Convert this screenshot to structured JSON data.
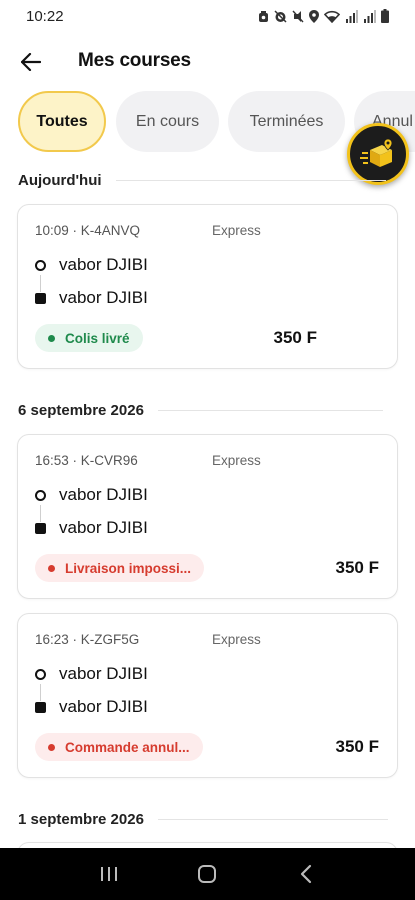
{
  "status_bar": {
    "time": "10:22",
    "icons": [
      "alarm-icon",
      "mute-icon",
      "location-icon",
      "wifi-icon",
      "signal-icon",
      "signal-icon",
      "battery-icon"
    ]
  },
  "header": {
    "back_icon": "arrow-left-icon",
    "title": "Mes courses"
  },
  "tabs": [
    {
      "label": "Toutes",
      "active": true
    },
    {
      "label": "En cours",
      "active": false
    },
    {
      "label": "Terminées",
      "active": false
    },
    {
      "label": "Annul",
      "active": false
    }
  ],
  "fab": {
    "icon": "delivery-box-icon"
  },
  "sections": [
    {
      "title": "Aujourd'hui",
      "courses": [
        {
          "time": "10:09",
          "ref": "K-4ANVQ",
          "meta": "10:09 · K-4ANVQ",
          "type": "Express",
          "origin": "vabor DJIBI",
          "destination": "vabor DJIBI",
          "status": "Colis livré",
          "status_color": "#1f8a4c",
          "price": "350 F"
        }
      ]
    },
    {
      "title": "6 septembre 2026",
      "courses": [
        {
          "time": "16:53",
          "ref": "K-CVR96",
          "meta": "16:53 · K-CVR96",
          "type": "Express",
          "origin": "vabor DJIBI",
          "destination": "vabor DJIBI",
          "status": "Livraison impossi...",
          "status_color": "#d63c2f",
          "price": "350 F"
        },
        {
          "time": "16:23",
          "ref": "K-ZGF5G",
          "meta": "16:23 · K-ZGF5G",
          "type": "Express",
          "origin": "vabor DJIBI",
          "destination": "vabor DJIBI",
          "status": "Commande annul...",
          "status_color": "#d63c2f",
          "price": "350 F"
        }
      ]
    },
    {
      "title": "1 septembre 2026",
      "courses": []
    }
  ],
  "nav_bar": {
    "buttons": [
      "recent-apps-icon",
      "home-icon",
      "back-icon"
    ]
  }
}
